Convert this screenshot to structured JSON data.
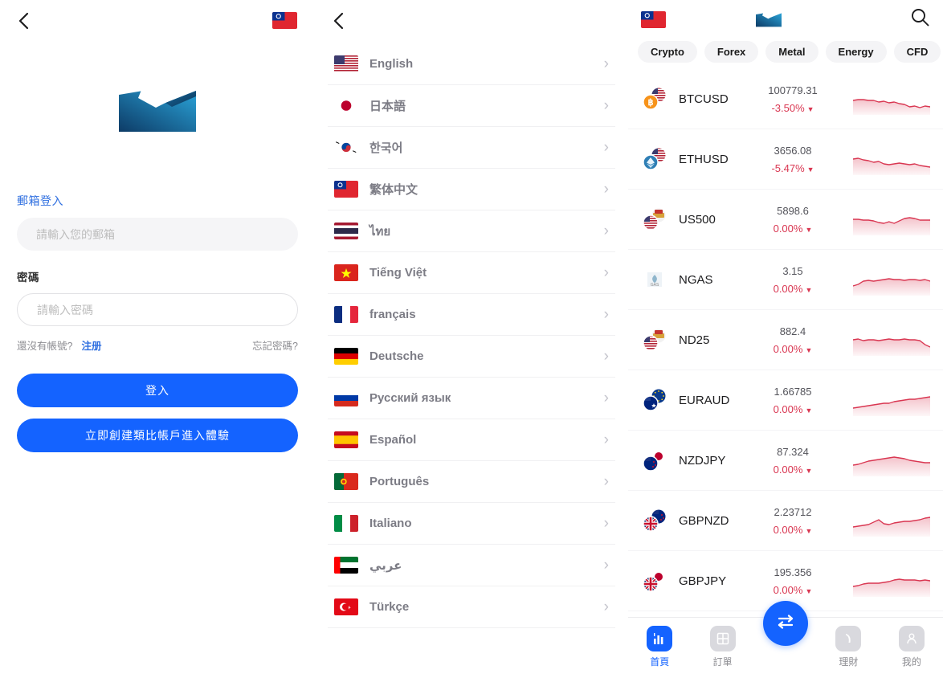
{
  "login": {
    "back_icon": "chevron-left-icon",
    "flag_icon": "taiwan-flag-icon",
    "logo_icon": "brand-logo-icon",
    "email_label": "郵箱登入",
    "email_placeholder": "請輸入您的郵箱",
    "email_value": "",
    "password_label": "密碼",
    "password_placeholder": "請輸入密碼",
    "password_value": "",
    "no_account_text": "還沒有帳號?",
    "register_link": "注册",
    "forgot_link": "忘記密碼?",
    "login_button": "登入",
    "demo_button": "立即創建類比帳戶進入體驗"
  },
  "language": {
    "back_icon": "chevron-left-icon",
    "items": [
      {
        "label": "English",
        "flag": "us-flag-icon",
        "chevron": "›"
      },
      {
        "label": "日本語",
        "flag": "japan-flag-icon",
        "chevron": "›"
      },
      {
        "label": "한국어",
        "flag": "korea-flag-icon",
        "chevron": "›"
      },
      {
        "label": "繁体中文",
        "flag": "taiwan-flag-icon",
        "chevron": "›"
      },
      {
        "label": "ไทย",
        "flag": "thailand-flag-icon",
        "chevron": "›"
      },
      {
        "label": "Tiếng Việt",
        "flag": "vietnam-flag-icon",
        "chevron": "›"
      },
      {
        "label": "français",
        "flag": "france-flag-icon",
        "chevron": "›"
      },
      {
        "label": "Deutsche",
        "flag": "germany-flag-icon",
        "chevron": "›"
      },
      {
        "label": "Русский язык",
        "flag": "russia-flag-icon",
        "chevron": "›"
      },
      {
        "label": "Español",
        "flag": "spain-flag-icon",
        "chevron": "›"
      },
      {
        "label": "Português",
        "flag": "portugal-flag-icon",
        "chevron": "›"
      },
      {
        "label": "Italiano",
        "flag": "italy-flag-icon",
        "chevron": "›"
      },
      {
        "label": "عربي",
        "flag": "uae-flag-icon",
        "chevron": "›"
      },
      {
        "label": "Türkçe",
        "flag": "turkey-flag-icon",
        "chevron": "›"
      }
    ]
  },
  "market": {
    "flag_icon": "taiwan-flag-icon",
    "logo_icon": "brand-logo-icon",
    "search_icon": "search-icon",
    "tabs": [
      {
        "label": "Crypto"
      },
      {
        "label": "Forex"
      },
      {
        "label": "Metal"
      },
      {
        "label": "Energy"
      },
      {
        "label": "CFD"
      }
    ],
    "down_color": "#d93651",
    "accent_color": "#1463ff",
    "rows": [
      {
        "symbol": "BTCUSD",
        "price": "100779.31",
        "change": "-3.50%",
        "caret": "▼",
        "icon": "btcusd-pair-icon",
        "spark": "0,22 8,21 16,21 24,22 32,22 40,24 48,23 56,25 64,24 72,26 80,27 88,30 96,29 104,31 112,29 120,30"
      },
      {
        "symbol": "ETHUSD",
        "price": "3656.08",
        "change": "-5.47%",
        "caret": "▼",
        "icon": "ethusd-pair-icon",
        "spark": "0,20 8,19 16,21 24,22 32,24 40,23 48,26 56,27 64,26 72,25 80,26 88,27 96,26 104,28 112,29 120,30"
      },
      {
        "symbol": "US500",
        "price": "5898.6",
        "change": "0.00%",
        "caret": "▼",
        "icon": "us500-index-icon",
        "spark": "0,20 8,20 16,21 24,21 32,22 40,24 48,25 56,23 64,25 72,22 80,19 88,18 96,19 104,21 112,21 120,21"
      },
      {
        "symbol": "NGAS",
        "price": "3.15",
        "change": "0.00%",
        "caret": "▼",
        "icon": "ngas-energy-icon",
        "spark": "0,28 8,26 16,22 24,21 32,22 40,21 48,20 56,19 64,20 72,20 80,21 88,20 96,20 104,21 112,20 120,22"
      },
      {
        "symbol": "ND25",
        "price": "882.4",
        "change": "0.00%",
        "caret": "▼",
        "icon": "nd25-index-icon",
        "spark": "0,20 8,19 16,21 24,20 32,20 40,21 48,20 56,19 64,20 72,20 80,19 88,20 96,20 104,21 112,26 120,29"
      },
      {
        "symbol": "EURAUD",
        "price": "1.66785",
        "change": "0.00%",
        "caret": "▼",
        "icon": "euraud-pair-icon",
        "spark": "0,30 8,29 16,28 24,27 32,26 40,25 48,24 56,24 64,22 72,21 80,20 88,19 96,19 104,18 112,17 120,16"
      },
      {
        "symbol": "NZDJPY",
        "price": "87.324",
        "change": "0.00%",
        "caret": "▼",
        "icon": "nzdjpy-pair-icon",
        "spark": "0,26 8,25 16,23 24,21 32,20 40,19 48,18 56,17 64,16 72,17 80,18 88,20 96,21 104,22 112,23 120,23"
      },
      {
        "symbol": "GBPNZD",
        "price": "2.23712",
        "change": "0.00%",
        "caret": "▼",
        "icon": "gbpnzd-pair-icon",
        "spark": "0,28 8,27 16,26 24,25 32,22 40,19 48,24 56,25 64,23 72,22 80,21 88,21 96,20 104,19 112,17 120,16"
      },
      {
        "symbol": "GBPJPY",
        "price": "195.356",
        "change": "0.00%",
        "caret": "▼",
        "icon": "gbpjpy-pair-icon",
        "spark": "0,27 8,26 16,24 24,23 32,23 40,23 48,22 56,21 64,19 72,18 80,19 88,19 96,19 104,20 112,19 120,20"
      }
    ],
    "fab_icon": "trade-swap-icon",
    "bottom_nav": [
      {
        "label": "首頁",
        "icon": "chart-bars-icon",
        "active": true
      },
      {
        "label": "訂單",
        "icon": "grid-squares-icon",
        "active": false
      },
      {
        "label": "理財",
        "icon": "clock-icon",
        "active": false
      },
      {
        "label": "我的",
        "icon": "person-icon",
        "active": false
      }
    ]
  }
}
